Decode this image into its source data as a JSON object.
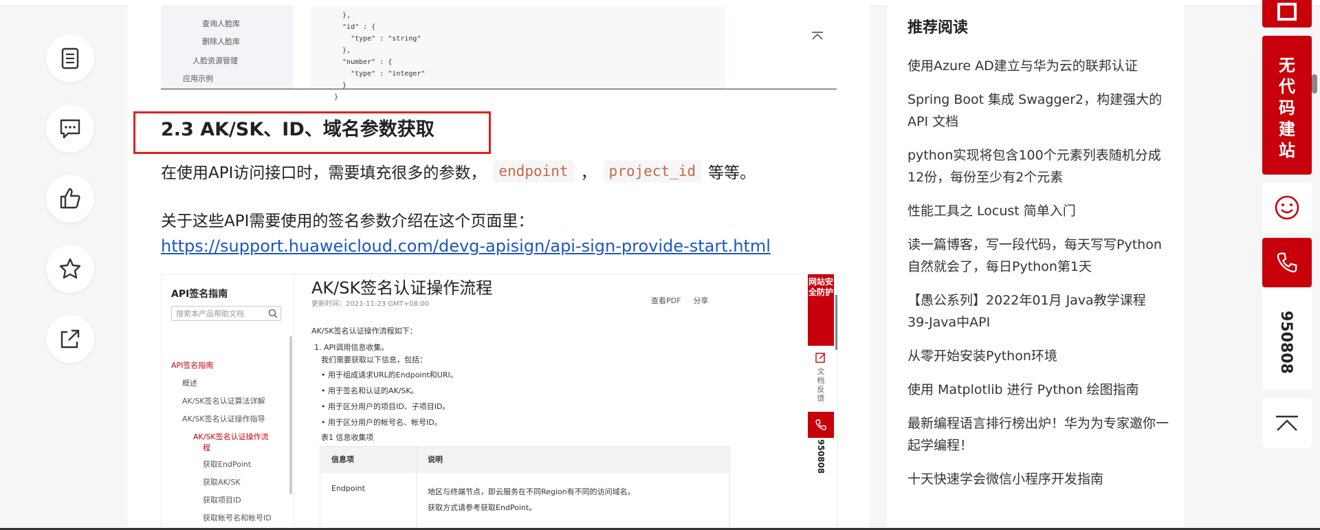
{
  "left_actions": [
    {
      "name": "toc-icon",
      "label": "目录"
    },
    {
      "name": "comment-icon",
      "label": "评论"
    },
    {
      "name": "like-icon",
      "label": "点赞"
    },
    {
      "name": "star-icon",
      "label": "收藏"
    },
    {
      "name": "share-icon",
      "label": "分享"
    }
  ],
  "code_snippet": {
    "nav_items": [
      "查询人脸库",
      "删除人脸库",
      "人脸资源管理",
      "应用示例"
    ],
    "code": "  },\n  \"id\" : {\n    \"type\" : \"string\"\n  },\n  \"number\" : {\n    \"type\" : \"integer\"\n  }\n}"
  },
  "article": {
    "heading": "2.3 AK/SK、ID、域名参数获取",
    "para1_prefix": "在使用API访问接口时，需要填充很多的参数，",
    "chip1": "endpoint",
    "para1_sep": "，",
    "chip2": "project_id",
    "para1_suffix": "等等。",
    "para2": "关于这些API需要使用的签名参数介绍在这个页面里：",
    "link": "https://support.huaweicloud.com/devg-apisign/api-sign-provide-start.html"
  },
  "doc_shot": {
    "nav_title": "API签名指南",
    "search_placeholder": "搜索本产品帮助文档",
    "nav_items": [
      "API签名指南",
      "概述",
      "AK/SK签名认证算法详解",
      "AK/SK签名认证操作指导",
      "AK/SK签名认证操作流",
      "程",
      "获取EndPoint",
      "获取AK/SK",
      "获取项目ID",
      "获取帐号名和帐号ID"
    ],
    "title": "AK/SK签名认证操作流程",
    "date": "更新时间：2021-11-23 GMT+08:00",
    "tool_pdf": "查看PDF",
    "tool_share": "分享",
    "lines": [
      "AK/SK签名认证操作流程如下：",
      "1. API调用信息收集。",
      "我们需要获取以下信息，包括：",
      "• 用于组成请求URL的Endpoint和URI。",
      "• 用于签名和认证的AK/SK。",
      "• 用于区分用户的项目ID、子项目ID。",
      "• 用于区分用户的帐号名、帐号ID。",
      "表1 信息收集项"
    ],
    "table_headers": [
      "信息项",
      "说明"
    ],
    "table_row": [
      "Endpoint",
      "地区与终端节点，即云服务在不同Region有不同的访问域名。",
      "获取方式请参考获取EndPoint。"
    ],
    "side_red": "网站安全防护",
    "side_feedback": "文档反馈",
    "side_phone": "950808"
  },
  "recommend": {
    "title": "推荐阅读",
    "items": [
      "使用Azure AD建立与华为云的联邦认证",
      "Spring Boot 集成 Swagger2，构建强大的 API 文档",
      "python实现将包含100个元素列表随机分成12份，每份至少有2个元素",
      "性能工具之 Locust 简单入门",
      "读一篇博客，写一段代码，每天写写Python自然就会了，每日Python第1天",
      "【愚公系列】2022年01月 Java教学课程 39-Java中API",
      "从零开始安装Python环境",
      "使用 Matplotlib 进行 Python 绘图指南",
      "最新编程语言排行榜出炉！华为为专家邀你一起学编程！",
      "十天快速学会微信小程序开发指南"
    ]
  },
  "right_float": {
    "nocode": "无代码建站",
    "phone": "950808"
  },
  "colors": {
    "brand_red": "#c7000b",
    "link_blue": "#1a56c4",
    "box_red": "#e02020"
  }
}
